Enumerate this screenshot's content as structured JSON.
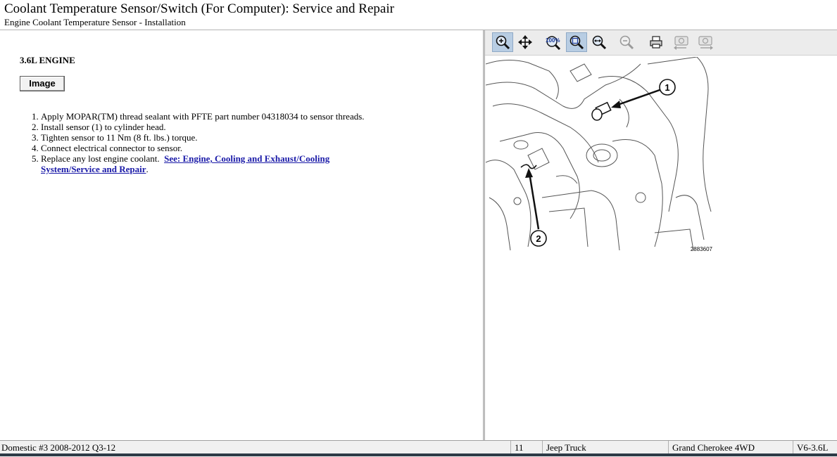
{
  "header": {
    "title": "Coolant Temperature Sensor/Switch (For Computer):  Service and Repair",
    "subtitle": "Engine Coolant Temperature Sensor - Installation"
  },
  "content": {
    "section_heading": "3.6L ENGINE",
    "image_button_label": "Image",
    "steps": [
      {
        "text": "Apply MOPAR(TM) thread sealant with PFTE part number 04318034 to sensor threads."
      },
      {
        "text": "Install sensor (1) to cylinder head."
      },
      {
        "text": "Tighten sensor to 11 Nm (8 ft. lbs.) torque."
      },
      {
        "text": "Connect electrical connector to sensor."
      },
      {
        "text": "Replace any lost engine coolant.",
        "link": "See: Engine, Cooling and Exhaust/Cooling System/Service and Repair",
        "suffix": "."
      }
    ]
  },
  "toolbar": {
    "buttons": [
      {
        "icon": "zoom-in-icon",
        "active": true
      },
      {
        "icon": "pan-icon",
        "active": false
      },
      {
        "icon": "zoom-100-icon",
        "label": "100%",
        "active": false
      },
      {
        "icon": "fit-to-window-icon",
        "active": true
      },
      {
        "icon": "fit-width-icon",
        "active": false
      },
      {
        "icon": "zoom-out-icon",
        "active": false
      },
      {
        "icon": "print-icon",
        "active": false
      },
      {
        "icon": "previous-image-icon",
        "active": false
      },
      {
        "icon": "next-image-icon",
        "active": false
      }
    ]
  },
  "figure": {
    "callouts": [
      "1",
      "2"
    ],
    "figure_number": "2883607"
  },
  "statusbar": {
    "database": "Domestic #3 2008-2012 Q3-12",
    "year": "11",
    "make": "Jeep Truck",
    "model": "Grand Cherokee 4WD",
    "engine": "V6-3.6L"
  },
  "colors": {
    "link": "#1a1aa8",
    "toolbar_active": "#b8cde3",
    "toolbar_bg": "#ececec"
  }
}
